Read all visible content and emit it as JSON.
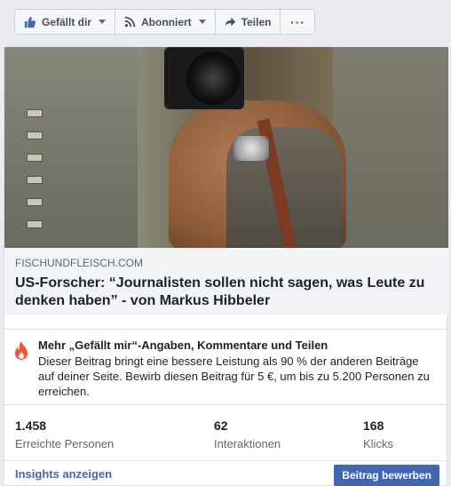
{
  "actions": {
    "like_label": "Gefällt dir",
    "follow_label": "Abonniert",
    "share_label": "Teilen",
    "more_label": "···"
  },
  "link_preview": {
    "domain": "FISCHUNDFLEISCH.COM",
    "headline": "US-Forscher: “Journalisten sollen nicht sagen, was Leute zu denken haben” - von Markus Hibbeler"
  },
  "boost_notice": {
    "title": "Mehr „Gefällt mir“-Angaben, Kommentare und Teilen",
    "text": "Dieser Beitrag bringt eine bessere Leistung als 90 % der anderen Beiträge auf deiner Seite. Bewirb diesen Beitrag für 5 €, um bis zu 5.200 Personen zu erreichen."
  },
  "stats": [
    {
      "value": "1.458",
      "label": "Erreichte Personen"
    },
    {
      "value": "62",
      "label": "Interaktionen"
    },
    {
      "value": "168",
      "label": "Klicks"
    }
  ],
  "footer": {
    "insights_label": "Insights anzeigen",
    "boost_label": "Beitrag bewerben"
  },
  "colors": {
    "accent": "#4267b2",
    "flame": "#f5533d"
  }
}
